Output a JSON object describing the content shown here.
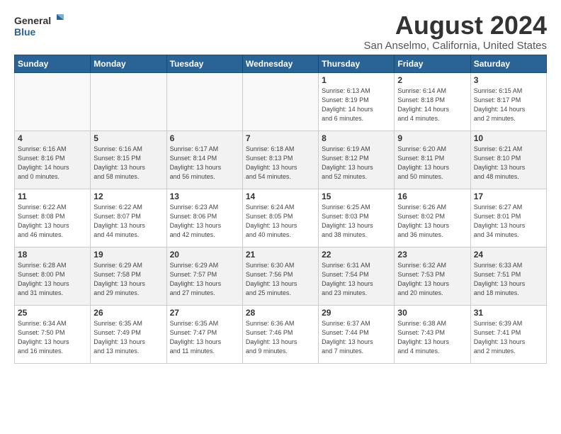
{
  "header": {
    "logo_line1": "General",
    "logo_line2": "Blue",
    "title": "August 2024",
    "subtitle": "San Anselmo, California, United States"
  },
  "weekdays": [
    "Sunday",
    "Monday",
    "Tuesday",
    "Wednesday",
    "Thursday",
    "Friday",
    "Saturday"
  ],
  "weeks": [
    [
      {
        "day": "",
        "info": ""
      },
      {
        "day": "",
        "info": ""
      },
      {
        "day": "",
        "info": ""
      },
      {
        "day": "",
        "info": ""
      },
      {
        "day": "1",
        "info": "Sunrise: 6:13 AM\nSunset: 8:19 PM\nDaylight: 14 hours\nand 6 minutes."
      },
      {
        "day": "2",
        "info": "Sunrise: 6:14 AM\nSunset: 8:18 PM\nDaylight: 14 hours\nand 4 minutes."
      },
      {
        "day": "3",
        "info": "Sunrise: 6:15 AM\nSunset: 8:17 PM\nDaylight: 14 hours\nand 2 minutes."
      }
    ],
    [
      {
        "day": "4",
        "info": "Sunrise: 6:16 AM\nSunset: 8:16 PM\nDaylight: 14 hours\nand 0 minutes."
      },
      {
        "day": "5",
        "info": "Sunrise: 6:16 AM\nSunset: 8:15 PM\nDaylight: 13 hours\nand 58 minutes."
      },
      {
        "day": "6",
        "info": "Sunrise: 6:17 AM\nSunset: 8:14 PM\nDaylight: 13 hours\nand 56 minutes."
      },
      {
        "day": "7",
        "info": "Sunrise: 6:18 AM\nSunset: 8:13 PM\nDaylight: 13 hours\nand 54 minutes."
      },
      {
        "day": "8",
        "info": "Sunrise: 6:19 AM\nSunset: 8:12 PM\nDaylight: 13 hours\nand 52 minutes."
      },
      {
        "day": "9",
        "info": "Sunrise: 6:20 AM\nSunset: 8:11 PM\nDaylight: 13 hours\nand 50 minutes."
      },
      {
        "day": "10",
        "info": "Sunrise: 6:21 AM\nSunset: 8:10 PM\nDaylight: 13 hours\nand 48 minutes."
      }
    ],
    [
      {
        "day": "11",
        "info": "Sunrise: 6:22 AM\nSunset: 8:08 PM\nDaylight: 13 hours\nand 46 minutes."
      },
      {
        "day": "12",
        "info": "Sunrise: 6:22 AM\nSunset: 8:07 PM\nDaylight: 13 hours\nand 44 minutes."
      },
      {
        "day": "13",
        "info": "Sunrise: 6:23 AM\nSunset: 8:06 PM\nDaylight: 13 hours\nand 42 minutes."
      },
      {
        "day": "14",
        "info": "Sunrise: 6:24 AM\nSunset: 8:05 PM\nDaylight: 13 hours\nand 40 minutes."
      },
      {
        "day": "15",
        "info": "Sunrise: 6:25 AM\nSunset: 8:03 PM\nDaylight: 13 hours\nand 38 minutes."
      },
      {
        "day": "16",
        "info": "Sunrise: 6:26 AM\nSunset: 8:02 PM\nDaylight: 13 hours\nand 36 minutes."
      },
      {
        "day": "17",
        "info": "Sunrise: 6:27 AM\nSunset: 8:01 PM\nDaylight: 13 hours\nand 34 minutes."
      }
    ],
    [
      {
        "day": "18",
        "info": "Sunrise: 6:28 AM\nSunset: 8:00 PM\nDaylight: 13 hours\nand 31 minutes."
      },
      {
        "day": "19",
        "info": "Sunrise: 6:29 AM\nSunset: 7:58 PM\nDaylight: 13 hours\nand 29 minutes."
      },
      {
        "day": "20",
        "info": "Sunrise: 6:29 AM\nSunset: 7:57 PM\nDaylight: 13 hours\nand 27 minutes."
      },
      {
        "day": "21",
        "info": "Sunrise: 6:30 AM\nSunset: 7:56 PM\nDaylight: 13 hours\nand 25 minutes."
      },
      {
        "day": "22",
        "info": "Sunrise: 6:31 AM\nSunset: 7:54 PM\nDaylight: 13 hours\nand 23 minutes."
      },
      {
        "day": "23",
        "info": "Sunrise: 6:32 AM\nSunset: 7:53 PM\nDaylight: 13 hours\nand 20 minutes."
      },
      {
        "day": "24",
        "info": "Sunrise: 6:33 AM\nSunset: 7:51 PM\nDaylight: 13 hours\nand 18 minutes."
      }
    ],
    [
      {
        "day": "25",
        "info": "Sunrise: 6:34 AM\nSunset: 7:50 PM\nDaylight: 13 hours\nand 16 minutes."
      },
      {
        "day": "26",
        "info": "Sunrise: 6:35 AM\nSunset: 7:49 PM\nDaylight: 13 hours\nand 13 minutes."
      },
      {
        "day": "27",
        "info": "Sunrise: 6:35 AM\nSunset: 7:47 PM\nDaylight: 13 hours\nand 11 minutes."
      },
      {
        "day": "28",
        "info": "Sunrise: 6:36 AM\nSunset: 7:46 PM\nDaylight: 13 hours\nand 9 minutes."
      },
      {
        "day": "29",
        "info": "Sunrise: 6:37 AM\nSunset: 7:44 PM\nDaylight: 13 hours\nand 7 minutes."
      },
      {
        "day": "30",
        "info": "Sunrise: 6:38 AM\nSunset: 7:43 PM\nDaylight: 13 hours\nand 4 minutes."
      },
      {
        "day": "31",
        "info": "Sunrise: 6:39 AM\nSunset: 7:41 PM\nDaylight: 13 hours\nand 2 minutes."
      }
    ]
  ]
}
